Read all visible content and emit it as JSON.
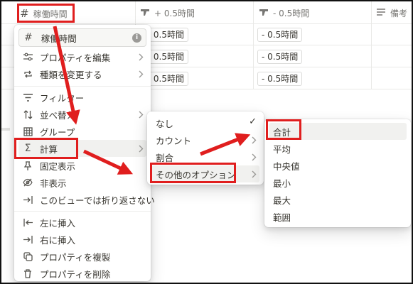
{
  "header": {
    "col1_label": "稼働時間",
    "col2_label": "+ 0.5時間",
    "col3_label": "- 0.5時間",
    "col4_label": "備考"
  },
  "rows": [
    {
      "plus": "+ 0.5時間",
      "minus": "- 0.5時間"
    },
    {
      "plus": "+ 0.5時間",
      "minus": "- 0.5時間"
    },
    {
      "plus": "+ 0.5時間",
      "minus": "- 0.5時間"
    }
  ],
  "property_menu": {
    "name_value": "稼働時間",
    "items": [
      {
        "label": "プロパティを編集",
        "icon": "sliders-icon"
      },
      {
        "label": "種類を変更する",
        "icon": "repeat-icon"
      },
      {
        "label": "フィルター",
        "icon": "filter-icon"
      },
      {
        "label": "並べ替え",
        "icon": "sort-icon"
      },
      {
        "label": "グループ",
        "icon": "grid-icon"
      },
      {
        "label": "計算",
        "icon": "sigma-icon"
      },
      {
        "label": "固定表示",
        "icon": "pin-icon"
      },
      {
        "label": "非表示",
        "icon": "eye-off-icon"
      },
      {
        "label": "このビューでは折り返さない",
        "icon": "no-wrap-icon"
      },
      {
        "label": "左に挿入",
        "icon": "insert-left-icon"
      },
      {
        "label": "右に挿入",
        "icon": "insert-right-icon"
      },
      {
        "label": "プロパティを複製",
        "icon": "duplicate-icon"
      },
      {
        "label": "プロパティを削除",
        "icon": "trash-icon"
      }
    ]
  },
  "calc_menu": {
    "items": [
      "なし",
      "カウント",
      "割合",
      "その他のオプション"
    ]
  },
  "options_menu": {
    "items": [
      "合計",
      "平均",
      "中央値",
      "最小",
      "最大",
      "範囲"
    ]
  },
  "colors": {
    "highlight_red": "#e01e1e",
    "text": "#37352f",
    "muted": "#787774"
  }
}
